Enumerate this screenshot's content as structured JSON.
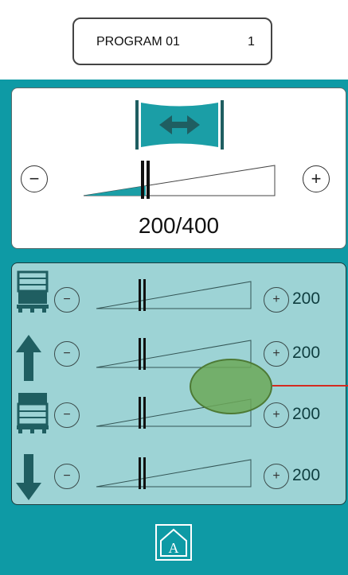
{
  "header": {
    "program_name": "PROGRAM 01",
    "program_number": "1"
  },
  "main_control": {
    "icon": "width-stretch-icon",
    "minus_label": "−",
    "plus_label": "+",
    "value": 200,
    "max": 400,
    "value_text": "200/400"
  },
  "rows": [
    {
      "icon": "pallet-bottom-icon",
      "minus_label": "−",
      "plus_label": "+",
      "value": "200"
    },
    {
      "icon": "arrow-up-icon",
      "minus_label": "−",
      "plus_label": "+",
      "value": "200"
    },
    {
      "icon": "pallet-top-icon",
      "minus_label": "−",
      "plus_label": "+",
      "value": "200"
    },
    {
      "icon": "arrow-down-icon",
      "minus_label": "−",
      "plus_label": "+",
      "value": "200"
    }
  ],
  "footer": {
    "home_icon": "home-a-icon",
    "home_letter": "A"
  },
  "colors": {
    "frame": "#0e9aa5",
    "panel": "#9dd3d5",
    "accent": "#1b9ea6",
    "dark": "#1f5e61"
  }
}
